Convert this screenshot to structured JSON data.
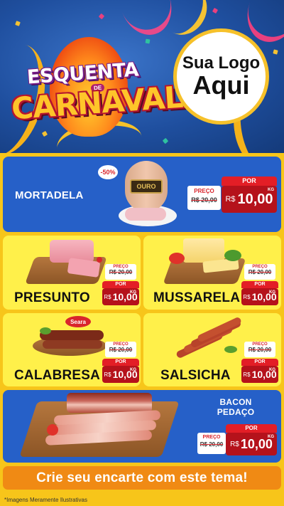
{
  "header": {
    "title_line1": "ESQUENTA",
    "title_de": "DE",
    "title_line2": "CARNAVAL",
    "logo_line1": "Sua Logo",
    "logo_line2": "Aqui"
  },
  "products": {
    "mortadela": {
      "name": "MORTADELA",
      "discount": "-50%",
      "brand": "OURO",
      "por": "POR",
      "preco_label": "PREÇO",
      "old_price": "R$ 20,00",
      "currency": "R$",
      "new_price": "10,00",
      "unit": "KG"
    },
    "presunto": {
      "name": "PRESUNTO",
      "preco_label": "PREÇO",
      "old_price": "R$ 20,00",
      "por": "POR",
      "currency": "R$",
      "new_price": "10,00",
      "unit": "KG"
    },
    "mussarela": {
      "name": "MUSSARELA",
      "preco_label": "PREÇO",
      "old_price": "R$ 20,00",
      "por": "POR",
      "currency": "R$",
      "new_price": "10,00",
      "unit": "KG"
    },
    "calabresa": {
      "name": "CALABRESA",
      "brand": "Seara",
      "preco_label": "PREÇO",
      "old_price": "R$ 20,00",
      "por": "POR",
      "currency": "R$",
      "new_price": "10,00",
      "unit": "KG"
    },
    "salsicha": {
      "name": "SALSICHA",
      "preco_label": "PREÇO",
      "old_price": "R$ 20,00",
      "por": "POR",
      "currency": "R$",
      "new_price": "10,00",
      "unit": "KG"
    },
    "bacon": {
      "name_line1": "BACON",
      "name_line2": "PEDAÇO",
      "preco_label": "PREÇO",
      "old_price": "R$ 20,00",
      "por": "POR",
      "currency": "R$",
      "new_price": "10,00",
      "unit": "KG"
    }
  },
  "footer": {
    "cta": "Crie seu encarte com este tema!",
    "disclaimer": "*Imagens Meramente Ilustrativas"
  },
  "colors": {
    "background": "#f7c51a",
    "header_blue": "#1f4f9f",
    "card_blue": "#2660c8",
    "card_yellow": "#fff04a",
    "price_red": "#b5121b",
    "por_red": "#e31e26",
    "cta_orange": "#f08a14"
  }
}
